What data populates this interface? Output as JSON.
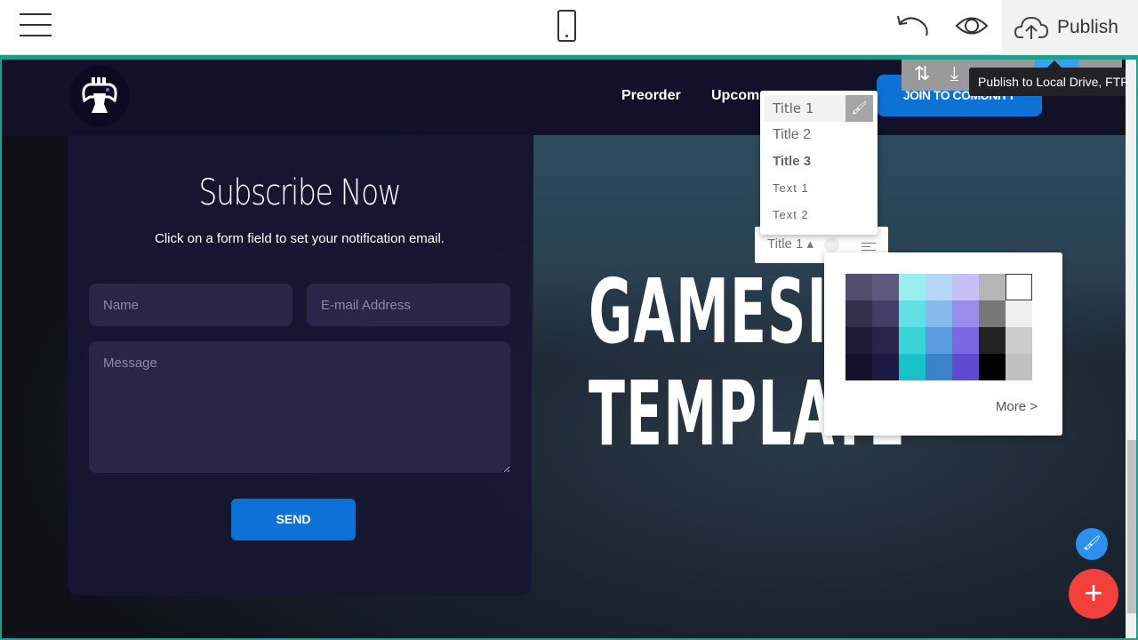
{
  "topbar": {
    "publish_label": "Publish",
    "icons": [
      "hamburger-menu-icon",
      "mobile-preview-icon",
      "undo-icon",
      "preview-eye-icon",
      "cloud-upload-icon"
    ]
  },
  "block_tools": {
    "tooltip": "Publish to Local Drive, FTP"
  },
  "nav": {
    "links": [
      "Preorder",
      "Upcom"
    ],
    "cta": "JOIN TO COMUNITY"
  },
  "form": {
    "title": "Subscribe Now",
    "subtitle": "Click on a form field to set your notification email.",
    "name_placeholder": "Name",
    "email_placeholder": "E-mail Address",
    "message_placeholder": "Message",
    "send_label": "SEND"
  },
  "hero": {
    "line1": "GAMESI",
    "line2": "TEMPLATE"
  },
  "style_dropdown": {
    "items": [
      "Title 1",
      "Title 2",
      "Title 3",
      "Text 1",
      "Text 2"
    ],
    "selected": "Title 1"
  },
  "mini_toolbar": {
    "style_label": "Title 1"
  },
  "palette": {
    "colors": [
      "#524f6e",
      "#5d5a80",
      "#9bedf0",
      "#b5d6f5",
      "#c7bff5",
      "#b5b5b5",
      "#ffffff",
      "#33314a",
      "#423e66",
      "#63dfe6",
      "#87b8eb",
      "#9a8de9",
      "#777777",
      "#efefef",
      "#1e1c36",
      "#28254a",
      "#3bd3da",
      "#5b9cde",
      "#7c68e2",
      "#232323",
      "#cccccc",
      "#15132b",
      "#1c1a42",
      "#19c1cb",
      "#3a83cc",
      "#5f4ad0",
      "#000000",
      "#c1c1c1"
    ],
    "selected": "#ffffff",
    "more_label": "More >"
  },
  "colors": {
    "accent": "#0c72d6",
    "fab_add": "#f2403c",
    "fab_brush": "#2d8ff0",
    "frame": "#1e9f8c"
  }
}
